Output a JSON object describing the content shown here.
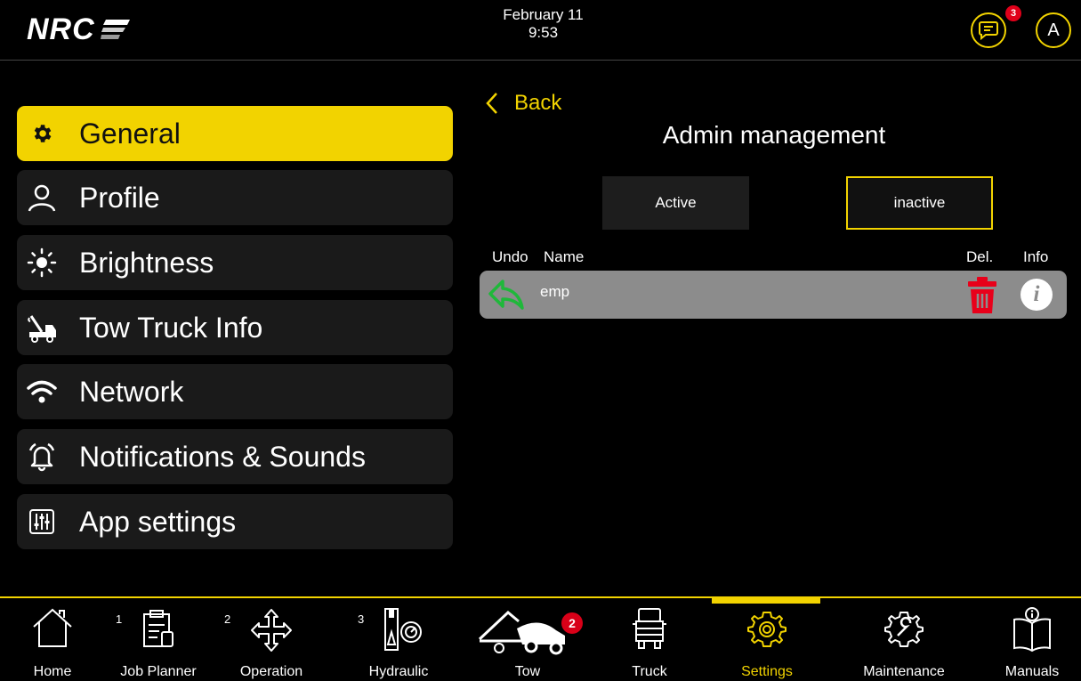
{
  "header": {
    "logo_text": "NRC",
    "date": "February 11",
    "time": "9:53",
    "message_count": "3",
    "avatar_initial": "A"
  },
  "menu": {
    "items": [
      {
        "label": "General",
        "icon": "gear-icon",
        "active": true
      },
      {
        "label": "Profile",
        "icon": "person-icon"
      },
      {
        "label": "Brightness",
        "icon": "sun-icon"
      },
      {
        "label": "Tow Truck Info",
        "icon": "tow-truck-icon"
      },
      {
        "label": "Network",
        "icon": "wifi-icon"
      },
      {
        "label": "Notifications & Sounds",
        "icon": "bell-icon"
      },
      {
        "label": "App settings",
        "icon": "sliders-icon"
      }
    ]
  },
  "content": {
    "back_label": "Back",
    "title": "Admin management",
    "tabs": {
      "active": "Active",
      "inactive": "inactive"
    },
    "columns": {
      "undo": "Undo",
      "name": "Name",
      "del": "Del.",
      "info": "Info"
    },
    "rows": [
      {
        "name": "emp"
      }
    ]
  },
  "bottom_nav": {
    "items": [
      {
        "label": "Home",
        "icon": "home-icon"
      },
      {
        "label": "Job Planner",
        "icon": "clipboard-icon",
        "number": "1"
      },
      {
        "label": "Operation",
        "icon": "move-arrows-icon",
        "number": "2"
      },
      {
        "label": "Hydraulic",
        "icon": "hydraulic-gauge-icon",
        "number": "3"
      },
      {
        "label": "Tow",
        "icon": "tow-icon",
        "badge": "2"
      },
      {
        "label": "Truck",
        "icon": "truck-icon"
      },
      {
        "label": "Settings",
        "icon": "settings-gear-icon",
        "active": true
      },
      {
        "label": "Maintenance",
        "icon": "maintenance-gear-icon"
      },
      {
        "label": "Manuals",
        "icon": "manual-book-icon"
      }
    ]
  },
  "colors": {
    "accent": "#f2d300",
    "badge": "#e0001a",
    "row": "#8c8c8c",
    "undo": "#1fb83a",
    "delete": "#e8001a"
  }
}
